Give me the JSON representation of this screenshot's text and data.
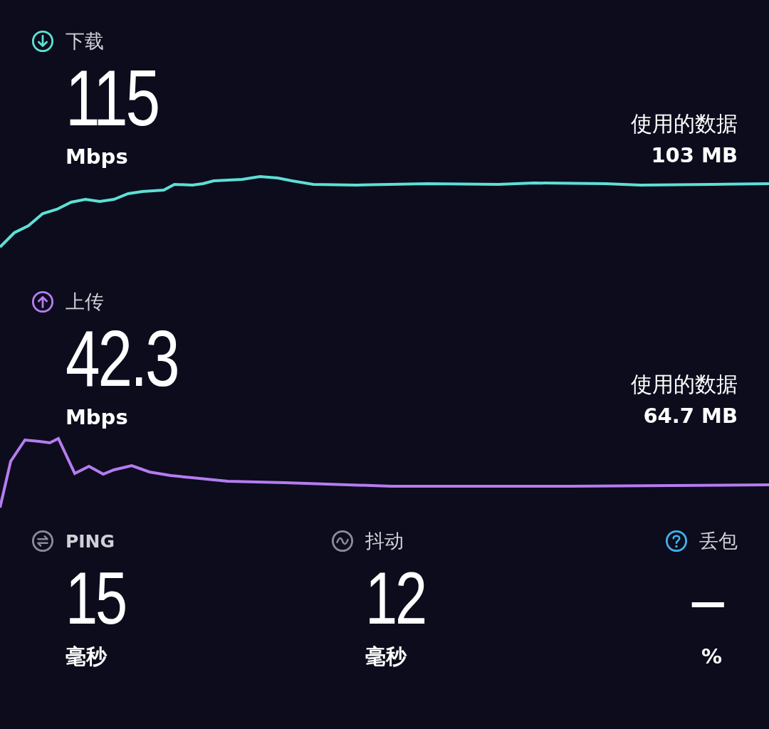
{
  "tests": [
    {
      "kind": "download",
      "label": "下载",
      "value": "115",
      "unit": "Mbps",
      "data_label": "使用的数据",
      "data_value": "103 MB",
      "color": "#5de0d5"
    },
    {
      "kind": "upload",
      "label": "上传",
      "value": "42.3",
      "unit": "Mbps",
      "data_label": "使用的数据",
      "data_value": "64.7 MB",
      "color": "#b57cf0"
    }
  ],
  "stats": [
    {
      "kind": "ping",
      "label": "PING",
      "value": "15",
      "unit": "毫秒"
    },
    {
      "kind": "jitter",
      "label": "抖动",
      "value": "12",
      "unit": "毫秒"
    },
    {
      "kind": "loss",
      "label": "丢包",
      "value": "–",
      "unit": "%"
    }
  ]
}
